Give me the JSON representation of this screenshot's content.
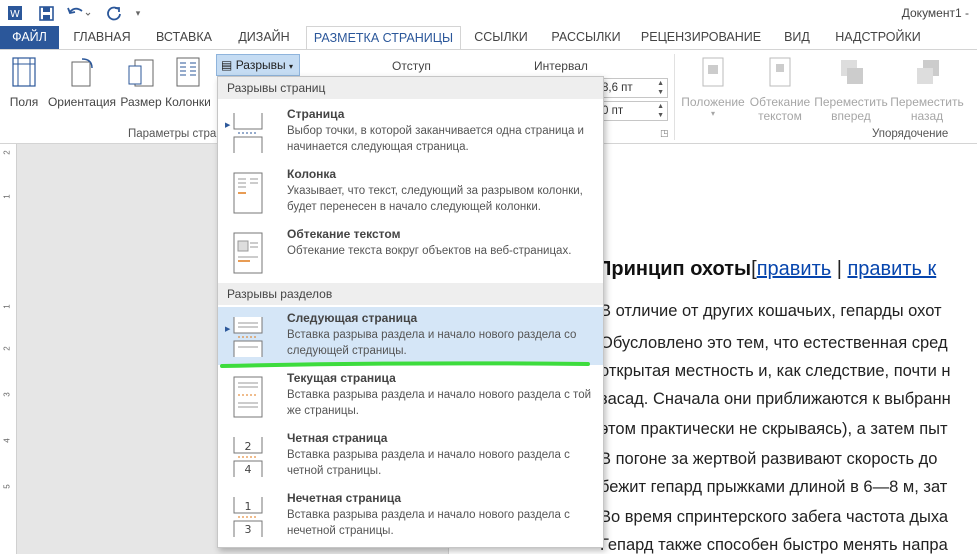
{
  "quick_access": {
    "undo_icon": "undo-icon",
    "redo_icon": "redo-icon",
    "save_icon": "save-icon",
    "app_icon": "word-icon"
  },
  "window_title": "Документ1 -",
  "tabs": [
    {
      "label": "ФАЙЛ"
    },
    {
      "label": "ГЛАВНАЯ"
    },
    {
      "label": "ВСТАВКА"
    },
    {
      "label": "ДИЗАЙН"
    },
    {
      "label": "РАЗМЕТКА СТРАНИЦЫ"
    },
    {
      "label": "ССЫЛКИ"
    },
    {
      "label": "РАССЫЛКИ"
    },
    {
      "label": "РЕЦЕНЗИРОВАНИЕ"
    },
    {
      "label": "ВИД"
    },
    {
      "label": "НАДСТРОЙКИ"
    }
  ],
  "ribbon": {
    "page_setup": {
      "fields_label": "Поля",
      "orientation_label": "Ориентация",
      "size_label": "Размер",
      "columns_label": "Колонки",
      "breaks_label": "Разрывы",
      "group_label": "Параметры стра"
    },
    "paragraph": {
      "indent_label": "Отступ",
      "spacing_label": "Интервал",
      "spacing_before": "8,6 пт",
      "spacing_after": "0 пт"
    },
    "arrange": {
      "position_label": "Положение",
      "wrap_label": "Обтекание текстом",
      "wrap_line1": "Обтекание",
      "wrap_line2": "текстом",
      "forward_line1": "Переместить",
      "forward_line2": "вперед",
      "backward_line1": "Переместить",
      "backward_line2": "назад",
      "group_label": "Упорядочение"
    }
  },
  "breaks_menu": {
    "page_breaks_header": "Разрывы страниц",
    "section_breaks_header": "Разрывы разделов",
    "items": [
      {
        "title": "Страница",
        "desc": "Выбор точки, в которой заканчивается одна страница и начинается следующая страница."
      },
      {
        "title": "Колонка",
        "desc": "Указывает, что текст, следующий за разрывом колонки, будет перенесен в начало следующей колонки."
      },
      {
        "title": "Обтекание текстом",
        "desc": "Обтекание текста вокруг объектов на веб-страницах."
      },
      {
        "title": "Следующая страница",
        "desc": "Вставка разрыва раздела и начало нового раздела со следующей страницы."
      },
      {
        "title": "Текущая страница",
        "desc": "Вставка разрыва раздела и начало нового раздела с той же страницы."
      },
      {
        "title": "Четная страница",
        "desc": "Вставка разрыва раздела и начало нового раздела с четной страницы."
      },
      {
        "title": "Нечетная страница",
        "desc": "Вставка разрыва раздела и начало нового раздела с нечетной страницы."
      }
    ],
    "highlighted_item": "Следующая страница",
    "icon_numbers": [
      "2",
      "4",
      "1",
      "3"
    ]
  },
  "ruler_numbers": [
    "2",
    "1",
    "1",
    "2",
    "3",
    "4",
    "5"
  ],
  "document": {
    "heading": "Принцип охоты",
    "heading_bracket_open": "[",
    "heading_link1": "править",
    "heading_sep": " | ",
    "heading_link2": "править к",
    "lines": [
      "В отличие от других кошачьих, гепарды охот",
      "Обусловлено это тем, что естественная сред",
      "открытая местность и, как следствие, почти н",
      "засад. Сначала они приближаются к выбранн",
      "этом практически не скрываясь), а затем пыт",
      "В погоне за жертвой развивают скорость до",
      "бежит гепард прыжками длиной в 6—8 м, зат",
      "Во время спринтерского забега частота дыха",
      "Гепард также способен быстро менять напра"
    ]
  },
  "colors": {
    "accent": "#2b579a",
    "highlight": "#d5e6f7",
    "annotation_green": "#3ddc3d",
    "link": "#0645ad"
  }
}
